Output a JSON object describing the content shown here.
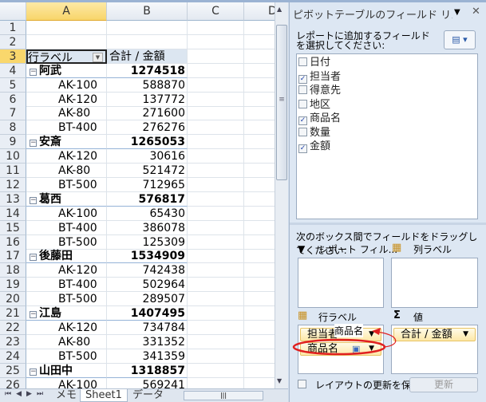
{
  "sheet": {
    "columns": [
      "A",
      "B",
      "C",
      "D"
    ],
    "header": {
      "row_label": "行ラベル",
      "sum_label": "合計 / 金額"
    },
    "rows": [
      {
        "n": "1"
      },
      {
        "n": "2"
      },
      {
        "n": "3",
        "type": "hdr"
      },
      {
        "n": "4",
        "type": "grp",
        "a": "阿武",
        "b": "1274518"
      },
      {
        "n": "5",
        "a": "AK-100",
        "b": "588870"
      },
      {
        "n": "6",
        "a": "AK-120",
        "b": "137772"
      },
      {
        "n": "7",
        "a": "AK-80",
        "b": "271600"
      },
      {
        "n": "8",
        "a": "BT-400",
        "b": "276276"
      },
      {
        "n": "9",
        "type": "grp",
        "a": "安斎",
        "b": "1265053"
      },
      {
        "n": "10",
        "a": "AK-120",
        "b": "30616"
      },
      {
        "n": "11",
        "a": "AK-80",
        "b": "521472"
      },
      {
        "n": "12",
        "a": "BT-500",
        "b": "712965"
      },
      {
        "n": "13",
        "type": "grp",
        "a": "葛西",
        "b": "576817"
      },
      {
        "n": "14",
        "a": "AK-100",
        "b": "65430"
      },
      {
        "n": "15",
        "a": "BT-400",
        "b": "386078"
      },
      {
        "n": "16",
        "a": "BT-500",
        "b": "125309"
      },
      {
        "n": "17",
        "type": "grp",
        "a": "後藤田",
        "b": "1534909"
      },
      {
        "n": "18",
        "a": "AK-120",
        "b": "742438"
      },
      {
        "n": "19",
        "a": "BT-400",
        "b": "502964"
      },
      {
        "n": "20",
        "a": "BT-500",
        "b": "289507"
      },
      {
        "n": "21",
        "type": "grp",
        "a": "江島",
        "b": "1407495"
      },
      {
        "n": "22",
        "a": "AK-120",
        "b": "734784"
      },
      {
        "n": "23",
        "a": "AK-80",
        "b": "331352"
      },
      {
        "n": "24",
        "a": "BT-500",
        "b": "341359"
      },
      {
        "n": "25",
        "type": "grp",
        "a": "山田中",
        "b": "1318857"
      },
      {
        "n": "26",
        "a": "AK-100",
        "b": "569241"
      }
    ],
    "tabs": [
      "メモ",
      "Sheet1",
      "データ"
    ],
    "active_tab": "Sheet1"
  },
  "panel": {
    "title": "ピボットテーブルのフィールド リスト",
    "choose_label": "レポートに追加するフィールドを選択してください:",
    "fields": [
      {
        "label": "日付",
        "checked": false
      },
      {
        "label": "担当者",
        "checked": true
      },
      {
        "label": "得意先",
        "checked": false
      },
      {
        "label": "地区",
        "checked": false
      },
      {
        "label": "商品名",
        "checked": true
      },
      {
        "label": "数量",
        "checked": false
      },
      {
        "label": "金額",
        "checked": true
      }
    ],
    "drag_label": "次のボックス間でフィールドをドラッグしてください:",
    "report_filter": "レポート フィル...",
    "column_labels": "列ラベル",
    "row_labels": "行ラベル",
    "values": "値",
    "row_items": [
      "担当者",
      "商品名"
    ],
    "drag_ghost": "商品名",
    "value_items": [
      "合計 / 金額"
    ],
    "defer_label": "レイアウトの更新を保...",
    "update_button": "更新",
    "annotation_color": "#e02020"
  }
}
